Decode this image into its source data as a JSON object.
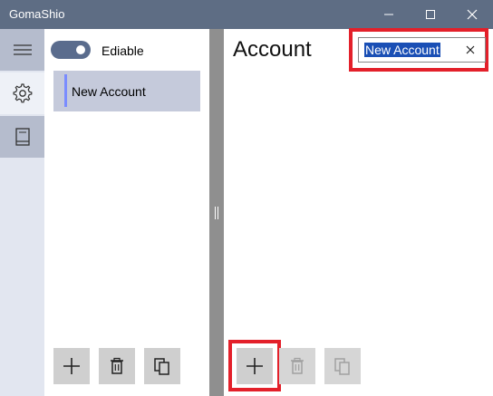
{
  "window": {
    "title": "GomaShio"
  },
  "rail": {
    "items": [
      {
        "icon": "hamburger-menu-icon"
      },
      {
        "icon": "gear-icon"
      },
      {
        "icon": "book-icon"
      }
    ]
  },
  "list_pane": {
    "toggle": {
      "label": "Ediable",
      "on": true
    },
    "items": [
      {
        "label": "New Account",
        "selected": true
      }
    ],
    "toolbar": [
      {
        "icon": "add-icon",
        "enabled": true
      },
      {
        "icon": "delete-icon",
        "enabled": true
      },
      {
        "icon": "copy-icon",
        "enabled": true
      }
    ]
  },
  "detail_pane": {
    "title": "Account",
    "name_field": {
      "value": "New Account",
      "selected": true
    },
    "toolbar": [
      {
        "icon": "add-icon",
        "enabled": true,
        "highlighted": true
      },
      {
        "icon": "delete-icon",
        "enabled": false
      },
      {
        "icon": "copy-icon",
        "enabled": false
      }
    ]
  },
  "colors": {
    "title_bar": "#5e6d84",
    "highlight": "#e3202a",
    "selection": "#1a4fb5",
    "list_accent": "#7a8cff"
  }
}
